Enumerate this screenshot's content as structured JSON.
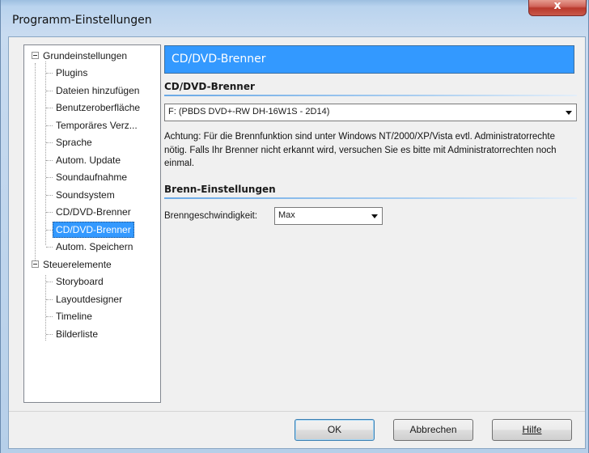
{
  "window": {
    "title": "Programm-Einstellungen",
    "close_glyph": "x"
  },
  "tree": {
    "groups": [
      {
        "label": "Grundeinstellungen",
        "expanded": true,
        "children": [
          "Plugins",
          "Dateien hinzufügen",
          "Benutzeroberfläche",
          "Temporäres Verz...",
          "Sprache",
          "Autom. Update",
          "Soundaufnahme",
          "Soundsystem",
          "CD/DVD-Brenner",
          "CD/DVD-Brenner",
          "Autom. Speichern"
        ]
      },
      {
        "label": "Steuerelemente",
        "expanded": true,
        "children": [
          "Storyboard",
          "Layoutdesigner",
          "Timeline",
          "Bilderliste"
        ]
      }
    ],
    "selected": "CD/DVD-Brenner"
  },
  "content": {
    "header": "CD/DVD-Brenner",
    "section1": {
      "title": "CD/DVD-Brenner",
      "drive_value": "F: (PBDS DVD+-RW DH-16W1S - 2D14)"
    },
    "note": "Achtung: Für die Brennfunktion sind unter Windows NT/2000/XP/Vista evtl. Administratorrechte nötig. Falls Ihr Brenner nicht erkannt wird, versuchen Sie es bitte mit Administratorrechten noch einmal.",
    "section2": {
      "title": "Brenn-Einstellungen",
      "speed_label": "Brenngeschwindigkeit:",
      "speed_value": "Max"
    }
  },
  "buttons": {
    "ok": "OK",
    "cancel": "Abbrechen",
    "help": "Hilfe"
  },
  "colors": {
    "accent": "#3399ff",
    "selection": "#3399ff",
    "close": "#c9584a"
  }
}
